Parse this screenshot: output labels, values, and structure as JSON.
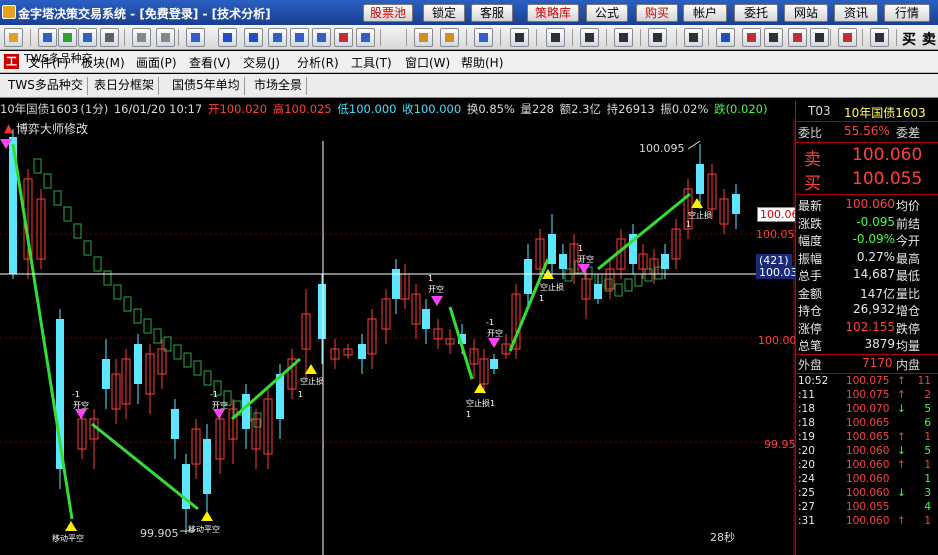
{
  "titlebar": {
    "title": "金字塔决策交易系统 - [免费登录] - [技术分析]",
    "buttons": [
      {
        "label": "股票池",
        "red": true
      },
      {
        "label": "锁定",
        "red": false
      },
      {
        "label": "客服",
        "red": false
      },
      {
        "label": "策略库",
        "red": true
      },
      {
        "label": "公式",
        "red": false
      },
      {
        "label": "购买",
        "red": true
      },
      {
        "label": "帐户",
        "red": false
      },
      {
        "label": "委托",
        "red": false
      },
      {
        "label": "网站",
        "red": false
      },
      {
        "label": "资讯",
        "red": false
      },
      {
        "label": "行情",
        "red": false
      }
    ]
  },
  "toolbar": {
    "buy_label": "买",
    "sell_label": "卖"
  },
  "menu": {
    "items": [
      "TWS多品种交",
      "文件(F)",
      "板块(M)",
      "画面(P)",
      "查看(V)",
      "交易(J)",
      "分析(R)",
      "工具(T)",
      "窗口(W)",
      "帮助(H)"
    ]
  },
  "tabs": [
    "表日分框架",
    "国债5年单均",
    "市场全景"
  ],
  "chart_header": {
    "symbol": "10年国债1603",
    "period": "(1分)",
    "datetime": "16/01/20 10:17",
    "open_label": "开",
    "open": "100.020",
    "high_label": "高",
    "high": "100.025",
    "low_label": "低",
    "low": "100.000",
    "close_label": "收",
    "close": "100.000",
    "turnover_label": "换",
    "turnover": "0.85%",
    "volume_label": "量",
    "volume": "228",
    "amount_label": "额",
    "amount": "2.3亿",
    "hold_label": "持",
    "hold": "26913",
    "amplitude_label": "振",
    "amplitude": "0.02%",
    "change_label": "跌",
    "change": "(0.020)"
  },
  "indicator_label": "博弈大师修改",
  "axis": {
    "price_labels": [
      "100.05",
      "100.00",
      "99.95"
    ],
    "current_price": "100.06",
    "crosshair_count": "(421)",
    "crosshair_price": "100.03",
    "low_annotation": "99.905",
    "high_annotation": "100.095",
    "countdown": "28秒"
  },
  "signals": {
    "open_short": "开空",
    "minus_one": "-1",
    "plus_one": "1",
    "move_close_short": "移动平空",
    "stop_profit": "空止损",
    "stop_profit_b": "空止损1"
  },
  "quote_panel": {
    "code": "T03",
    "name": "10年国债1603",
    "weibi_label": "委比",
    "weibi": "55.56%",
    "weicha_label": "委差",
    "sell_label": "卖",
    "sell_price": "100.060",
    "buy_label": "买",
    "buy_price": "100.055",
    "rows": [
      {
        "l1": "最新",
        "v1": "100.060",
        "l2": "均价",
        "color": "red"
      },
      {
        "l1": "涨跌",
        "v1": "-0.095",
        "l2": "前结",
        "color": "green"
      },
      {
        "l1": "幅度",
        "v1": "-0.09%",
        "l2": "今开",
        "color": "green"
      },
      {
        "l1": "振幅",
        "v1": "0.27%",
        "l2": "最高",
        "color": "white"
      },
      {
        "l1": "总手",
        "v1": "14,687",
        "l2": "最低",
        "color": "white"
      },
      {
        "l1": "金额",
        "v1": "147亿",
        "l2": "量比",
        "color": "white"
      },
      {
        "l1": "持仓",
        "v1": "26,932",
        "l2": "增仓",
        "color": "white"
      },
      {
        "l1": "涨停",
        "v1": "102.155",
        "l2": "跌停",
        "color": "red"
      },
      {
        "l1": "总笔",
        "v1": "3879",
        "l2": "均量",
        "color": "white"
      }
    ],
    "outer_label": "外盘",
    "outer": "7170",
    "inner_label": "内盘",
    "ticks": [
      {
        "t": "10:52",
        "p": "100.075",
        "dir": "↑",
        "v": "11"
      },
      {
        "t": ":11",
        "p": "100.075",
        "dir": "↑",
        "v": "2"
      },
      {
        "t": ":18",
        "p": "100.070",
        "dir": "↓",
        "v": "5"
      },
      {
        "t": ":18",
        "p": "100.065",
        "dir": "",
        "v": "6"
      },
      {
        "t": ":19",
        "p": "100.065",
        "dir": "↑",
        "v": "1"
      },
      {
        "t": ":20",
        "p": "100.060",
        "dir": "↓",
        "v": "5"
      },
      {
        "t": ":20",
        "p": "100.060",
        "dir": "↑",
        "v": "1"
      },
      {
        "t": ":24",
        "p": "100.060",
        "dir": "",
        "v": "1"
      },
      {
        "t": ":25",
        "p": "100.060",
        "dir": "↓",
        "v": "3"
      },
      {
        "t": ":27",
        "p": "100.055",
        "dir": "",
        "v": "4"
      },
      {
        "t": ":31",
        "p": "100.060",
        "dir": "↑",
        "v": "1"
      }
    ]
  },
  "colors": {
    "up": "#ff3c3c",
    "down": "#5ce6ff",
    "signal_line": "#33dd33",
    "stair": "#2ea84a"
  }
}
